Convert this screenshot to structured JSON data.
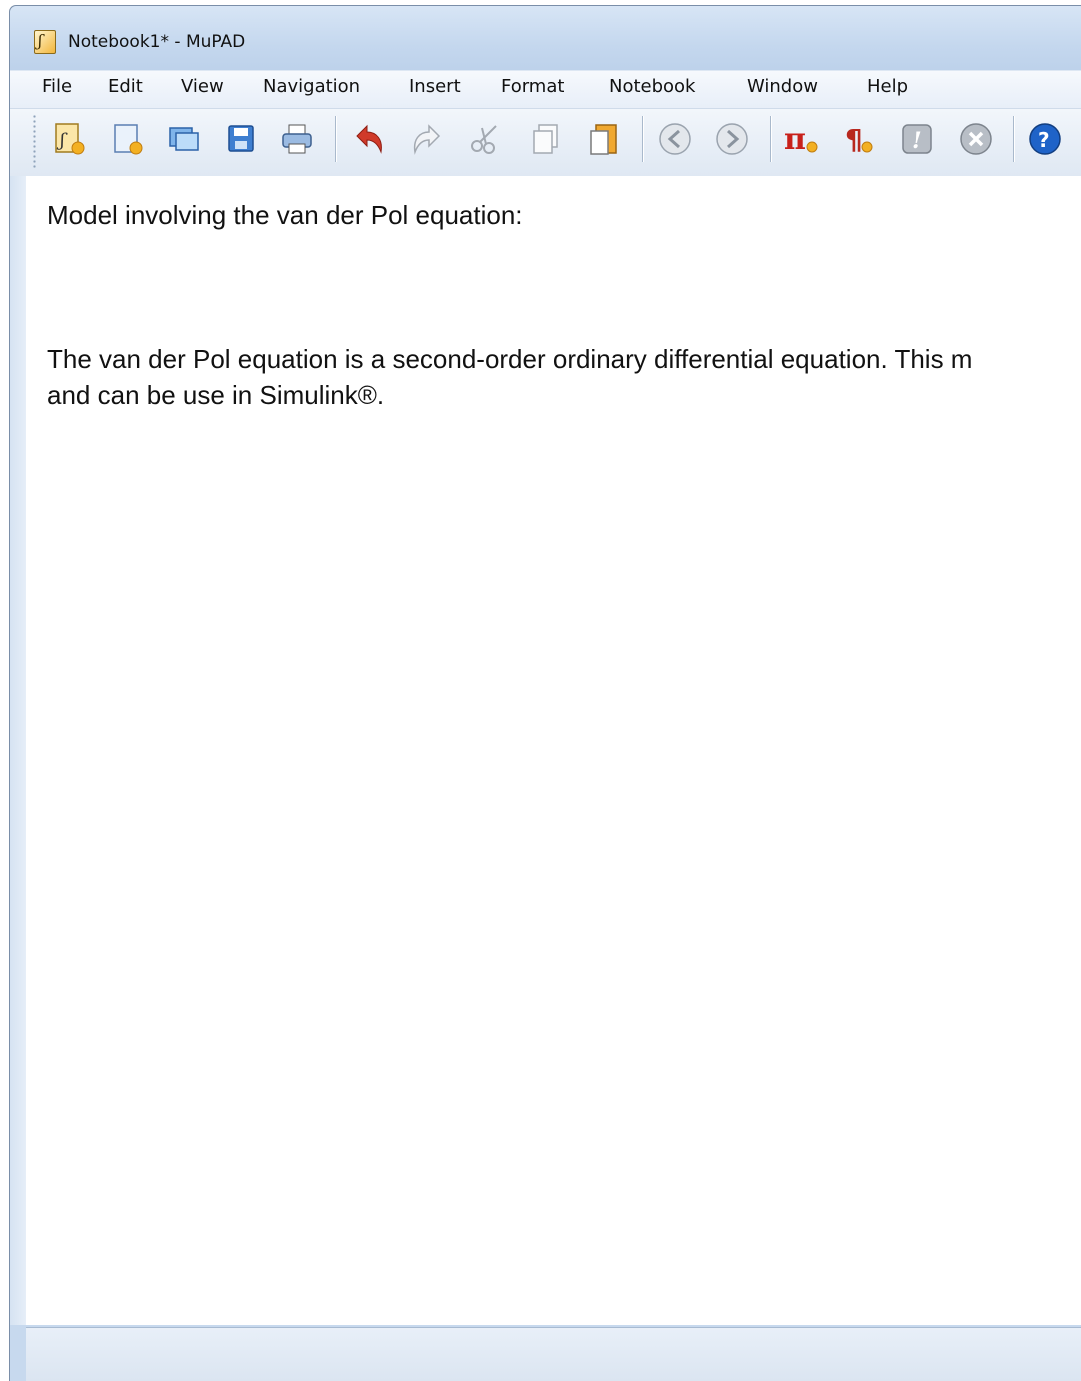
{
  "window": {
    "title": "Notebook1* - MuPAD",
    "app_icon": "mupad-notebook-icon"
  },
  "menu": [
    "File",
    "Edit",
    "View",
    "Navigation",
    "Insert",
    "Format",
    "Notebook",
    "Window",
    "Help"
  ],
  "toolbar": [
    {
      "icon": "new-notebook-icon"
    },
    {
      "icon": "new-editor-icon"
    },
    {
      "icon": "open-icon"
    },
    {
      "icon": "save-icon"
    },
    {
      "icon": "print-icon"
    },
    {
      "icon": "undo-icon"
    },
    {
      "icon": "redo-icon"
    },
    {
      "icon": "cut-icon"
    },
    {
      "icon": "copy-icon"
    },
    {
      "icon": "paste-icon"
    },
    {
      "icon": "back-icon"
    },
    {
      "icon": "forward-icon"
    },
    {
      "icon": "insert-calculation-icon"
    },
    {
      "icon": "insert-text-paragraph-icon"
    },
    {
      "icon": "evaluate-icon"
    },
    {
      "icon": "stop-evaluation-icon"
    },
    {
      "icon": "help-icon"
    }
  ],
  "document": {
    "paragraph_1": "Model involving the van der Pol equation:",
    "paragraph_2_line_1": "The van der Pol equation is a second-order ordinary differential equation. This m",
    "paragraph_2_line_2": "and can be use in Simulink®."
  },
  "colors": {
    "chrome": "#c7d9ee",
    "undo_red": "#d03a2a",
    "pi_red": "#c8201a",
    "help_blue": "#1f63c8"
  }
}
